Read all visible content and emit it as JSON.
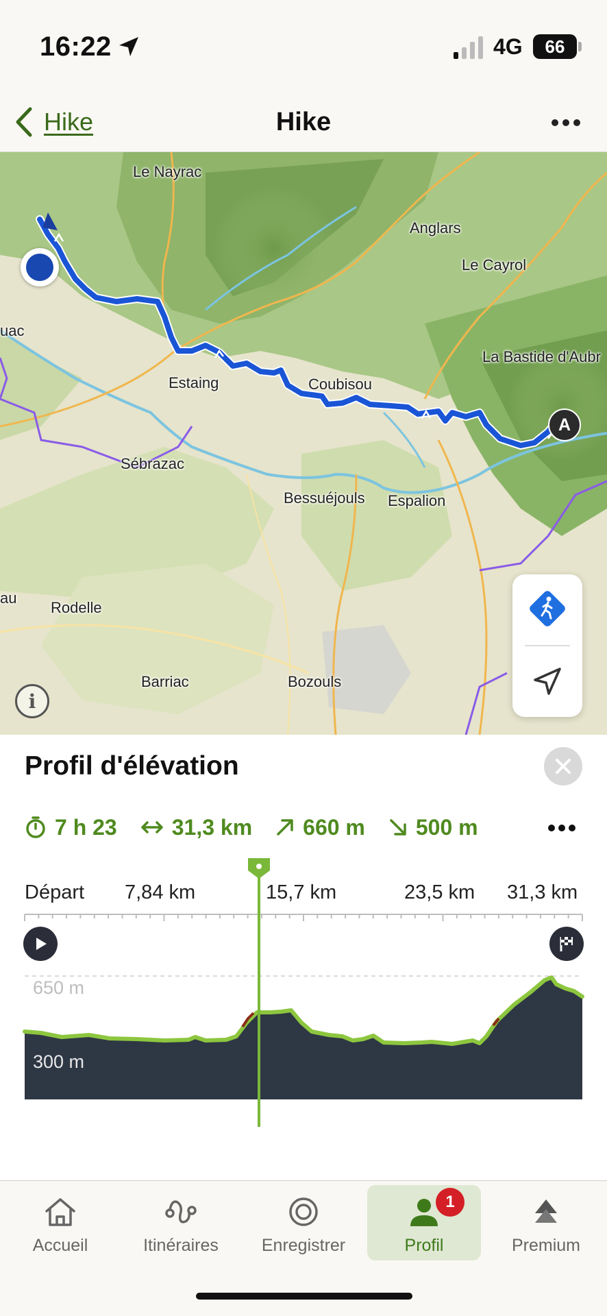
{
  "status_bar": {
    "time": "16:22",
    "network": "4G",
    "battery": "66"
  },
  "nav": {
    "back_label": "Hike",
    "title": "Hike"
  },
  "map": {
    "places": [
      {
        "name": "Le Nayrac"
      },
      {
        "name": "Anglars"
      },
      {
        "name": "Le Cayrol"
      },
      {
        "name": "La Bastide d'Aubr"
      },
      {
        "name": "uac"
      },
      {
        "name": "Estaing"
      },
      {
        "name": "Coubisou"
      },
      {
        "name": "Sébrazac"
      },
      {
        "name": "Bessuéjouls"
      },
      {
        "name": "Espalion"
      },
      {
        "name": "au"
      },
      {
        "name": "Rodelle"
      },
      {
        "name": "Barriac"
      },
      {
        "name": "Bozouls"
      }
    ],
    "start_marker": "A",
    "info_icon": "i",
    "controls": {
      "route_icon": "hiker-direction-icon",
      "locate_icon": "location-arrow-icon"
    }
  },
  "elevation": {
    "title": "Profil d'élévation",
    "stats": {
      "duration": "7 h 23",
      "distance": "31,3 km",
      "ascent": "660 m",
      "descent": "500 m"
    },
    "axis_labels": [
      "Départ",
      "7,84 km",
      "15,7 km",
      "23,5 km",
      "31,3 km"
    ],
    "elevation_labels": [
      "650 m",
      "300 m"
    ],
    "cursor_km": 12.5,
    "colors": {
      "line": "#8dc63f",
      "fill": "#2e3744",
      "steep": "#8b2c1a",
      "accent": "#4f8a1f"
    }
  },
  "tabs": [
    {
      "label": "Accueil",
      "icon": "home-icon"
    },
    {
      "label": "Itinéraires",
      "icon": "routes-icon"
    },
    {
      "label": "Enregistrer",
      "icon": "record-icon"
    },
    {
      "label": "Profil",
      "icon": "profile-icon",
      "badge": "1",
      "active": true
    },
    {
      "label": "Premium",
      "icon": "premium-icon"
    }
  ]
}
